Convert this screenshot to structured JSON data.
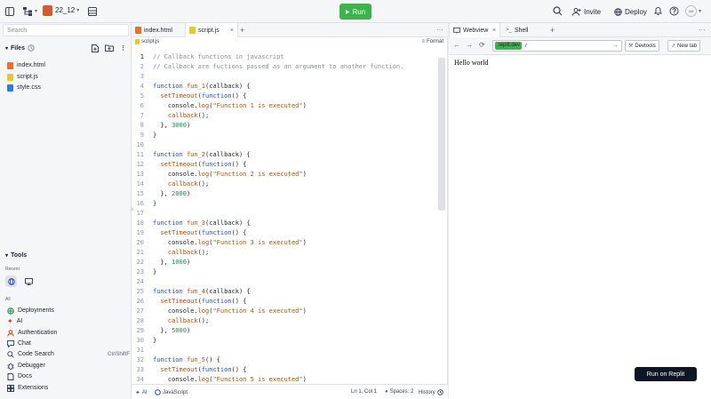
{
  "topbar": {
    "repl_name": "22_12",
    "run_label": "Run",
    "invite_label": "Invite",
    "deploy_label": "Deploy",
    "avatar_initials": "AB"
  },
  "sidebar": {
    "search_placeholder": "Search",
    "files_title": "Files",
    "files": [
      {
        "name": "index.html",
        "type": "html"
      },
      {
        "name": "script.js",
        "type": "js"
      },
      {
        "name": "style.css",
        "type": "css"
      }
    ],
    "tools_title": "Tools",
    "recent_label": "Recent",
    "all_label": "All",
    "tools": [
      {
        "label": "Deployments"
      },
      {
        "label": "AI"
      },
      {
        "label": "Authentication"
      },
      {
        "label": "Chat"
      },
      {
        "label": "Code Search",
        "shortcut": "CtrlShiftF"
      },
      {
        "label": "Debugger"
      },
      {
        "label": "Docs"
      },
      {
        "label": "Extensions"
      }
    ]
  },
  "editor": {
    "tabs": [
      {
        "label": "index.html",
        "active": false
      },
      {
        "label": "script.js",
        "active": true
      }
    ],
    "breadcrumb": "script.js",
    "format_label": "Format",
    "status": {
      "ai": "AI",
      "language": "JavaScript",
      "position": "Ln 1, Col 1",
      "spaces": "Spaces: 2",
      "history": "History"
    }
  },
  "code_lines": [
    [
      [
        "com",
        "// Callback functions in javascript"
      ]
    ],
    [
      [
        "com",
        "// Callback are fuctions passed as an argument to another function."
      ]
    ],
    [],
    [
      [
        "kw",
        "function "
      ],
      [
        "fn",
        "fun_1"
      ],
      [
        "",
        "(callback) {"
      ]
    ],
    [
      [
        "",
        "  "
      ],
      [
        "fn",
        "setTimeout"
      ],
      [
        "",
        "("
      ],
      [
        "kw",
        "function"
      ],
      [
        "",
        "() {"
      ]
    ],
    [
      [
        "",
        "    console."
      ],
      [
        "fn",
        "log"
      ],
      [
        "",
        "("
      ],
      [
        "str",
        "\"Function 1 is executed\""
      ],
      [
        "",
        ")"
      ]
    ],
    [
      [
        "",
        "    "
      ],
      [
        "fn",
        "callback"
      ],
      [
        "",
        "();"
      ]
    ],
    [
      [
        "",
        "  }, "
      ],
      [
        "num",
        "3000"
      ],
      [
        "",
        ")"
      ]
    ],
    [
      [
        "",
        "}"
      ]
    ],
    [],
    [
      [
        "kw",
        "function "
      ],
      [
        "fn",
        "fun_2"
      ],
      [
        "",
        "(callback) {"
      ]
    ],
    [
      [
        "",
        "  "
      ],
      [
        "fn",
        "setTimeout"
      ],
      [
        "",
        "("
      ],
      [
        "kw",
        "function"
      ],
      [
        "",
        "() {"
      ]
    ],
    [
      [
        "",
        "    console."
      ],
      [
        "fn",
        "log"
      ],
      [
        "",
        "("
      ],
      [
        "str",
        "\"Function 2 is executed\""
      ],
      [
        "",
        ")"
      ]
    ],
    [
      [
        "",
        "    "
      ],
      [
        "fn",
        "callback"
      ],
      [
        "",
        "();"
      ]
    ],
    [
      [
        "",
        "  }, "
      ],
      [
        "num",
        "2000"
      ],
      [
        "",
        ")"
      ]
    ],
    [
      [
        "",
        "}"
      ]
    ],
    [],
    [
      [
        "kw",
        "function "
      ],
      [
        "fn",
        "fun_3"
      ],
      [
        "",
        "(callback) {"
      ]
    ],
    [
      [
        "",
        "  "
      ],
      [
        "fn",
        "setTimeout"
      ],
      [
        "",
        "("
      ],
      [
        "kw",
        "function"
      ],
      [
        "",
        "() {"
      ]
    ],
    [
      [
        "",
        "    console."
      ],
      [
        "fn",
        "log"
      ],
      [
        "",
        "("
      ],
      [
        "str",
        "\"Function 3 is executed\""
      ],
      [
        "",
        ")"
      ]
    ],
    [
      [
        "",
        "    "
      ],
      [
        "fn",
        "callback"
      ],
      [
        "",
        "();"
      ]
    ],
    [
      [
        "",
        "  }, "
      ],
      [
        "num",
        "1000"
      ],
      [
        "",
        ")"
      ]
    ],
    [
      [
        "",
        "}"
      ]
    ],
    [],
    [
      [
        "kw",
        "function "
      ],
      [
        "fn",
        "fun_4"
      ],
      [
        "",
        "(callback) {"
      ]
    ],
    [
      [
        "",
        "  "
      ],
      [
        "fn",
        "setTimeout"
      ],
      [
        "",
        "("
      ],
      [
        "kw",
        "function"
      ],
      [
        "",
        "() {"
      ]
    ],
    [
      [
        "",
        "    console."
      ],
      [
        "fn",
        "log"
      ],
      [
        "",
        "("
      ],
      [
        "str",
        "\"Function 4 is executed\""
      ],
      [
        "",
        ")"
      ]
    ],
    [
      [
        "",
        "    "
      ],
      [
        "fn",
        "callback"
      ],
      [
        "",
        "();"
      ]
    ],
    [
      [
        "",
        "  }, "
      ],
      [
        "num",
        "5000"
      ],
      [
        "",
        ")"
      ]
    ],
    [
      [
        "",
        "}"
      ]
    ],
    [],
    [
      [
        "kw",
        "function "
      ],
      [
        "fn",
        "fun_5"
      ],
      [
        "",
        "() {"
      ]
    ],
    [
      [
        "",
        "  "
      ],
      [
        "fn",
        "setTimeout"
      ],
      [
        "",
        "("
      ],
      [
        "kw",
        "function"
      ],
      [
        "",
        "() {"
      ]
    ],
    [
      [
        "",
        "    console."
      ],
      [
        "fn",
        "log"
      ],
      [
        "",
        "("
      ],
      [
        "str",
        "\"Function 5 is executed\""
      ],
      [
        "",
        ")"
      ]
    ]
  ],
  "webview": {
    "tabs": [
      {
        "label": "Webview",
        "active": true
      },
      {
        "label": "Shell",
        "active": false
      }
    ],
    "url_domain": ".replit.dev",
    "url_path": "/",
    "devtools_label": "Devtools",
    "newtab_label": "New tab",
    "output_text": "Hello world",
    "run_on_replit_label": "Run on Replit"
  },
  "colors": {
    "run_green": "#3cb44b",
    "dark": "#0e1525",
    "keyword": "#1f4fd6",
    "function": "#c04b00",
    "string": "#b35600",
    "comment": "#8a8f98",
    "number": "#1f8b4c"
  }
}
